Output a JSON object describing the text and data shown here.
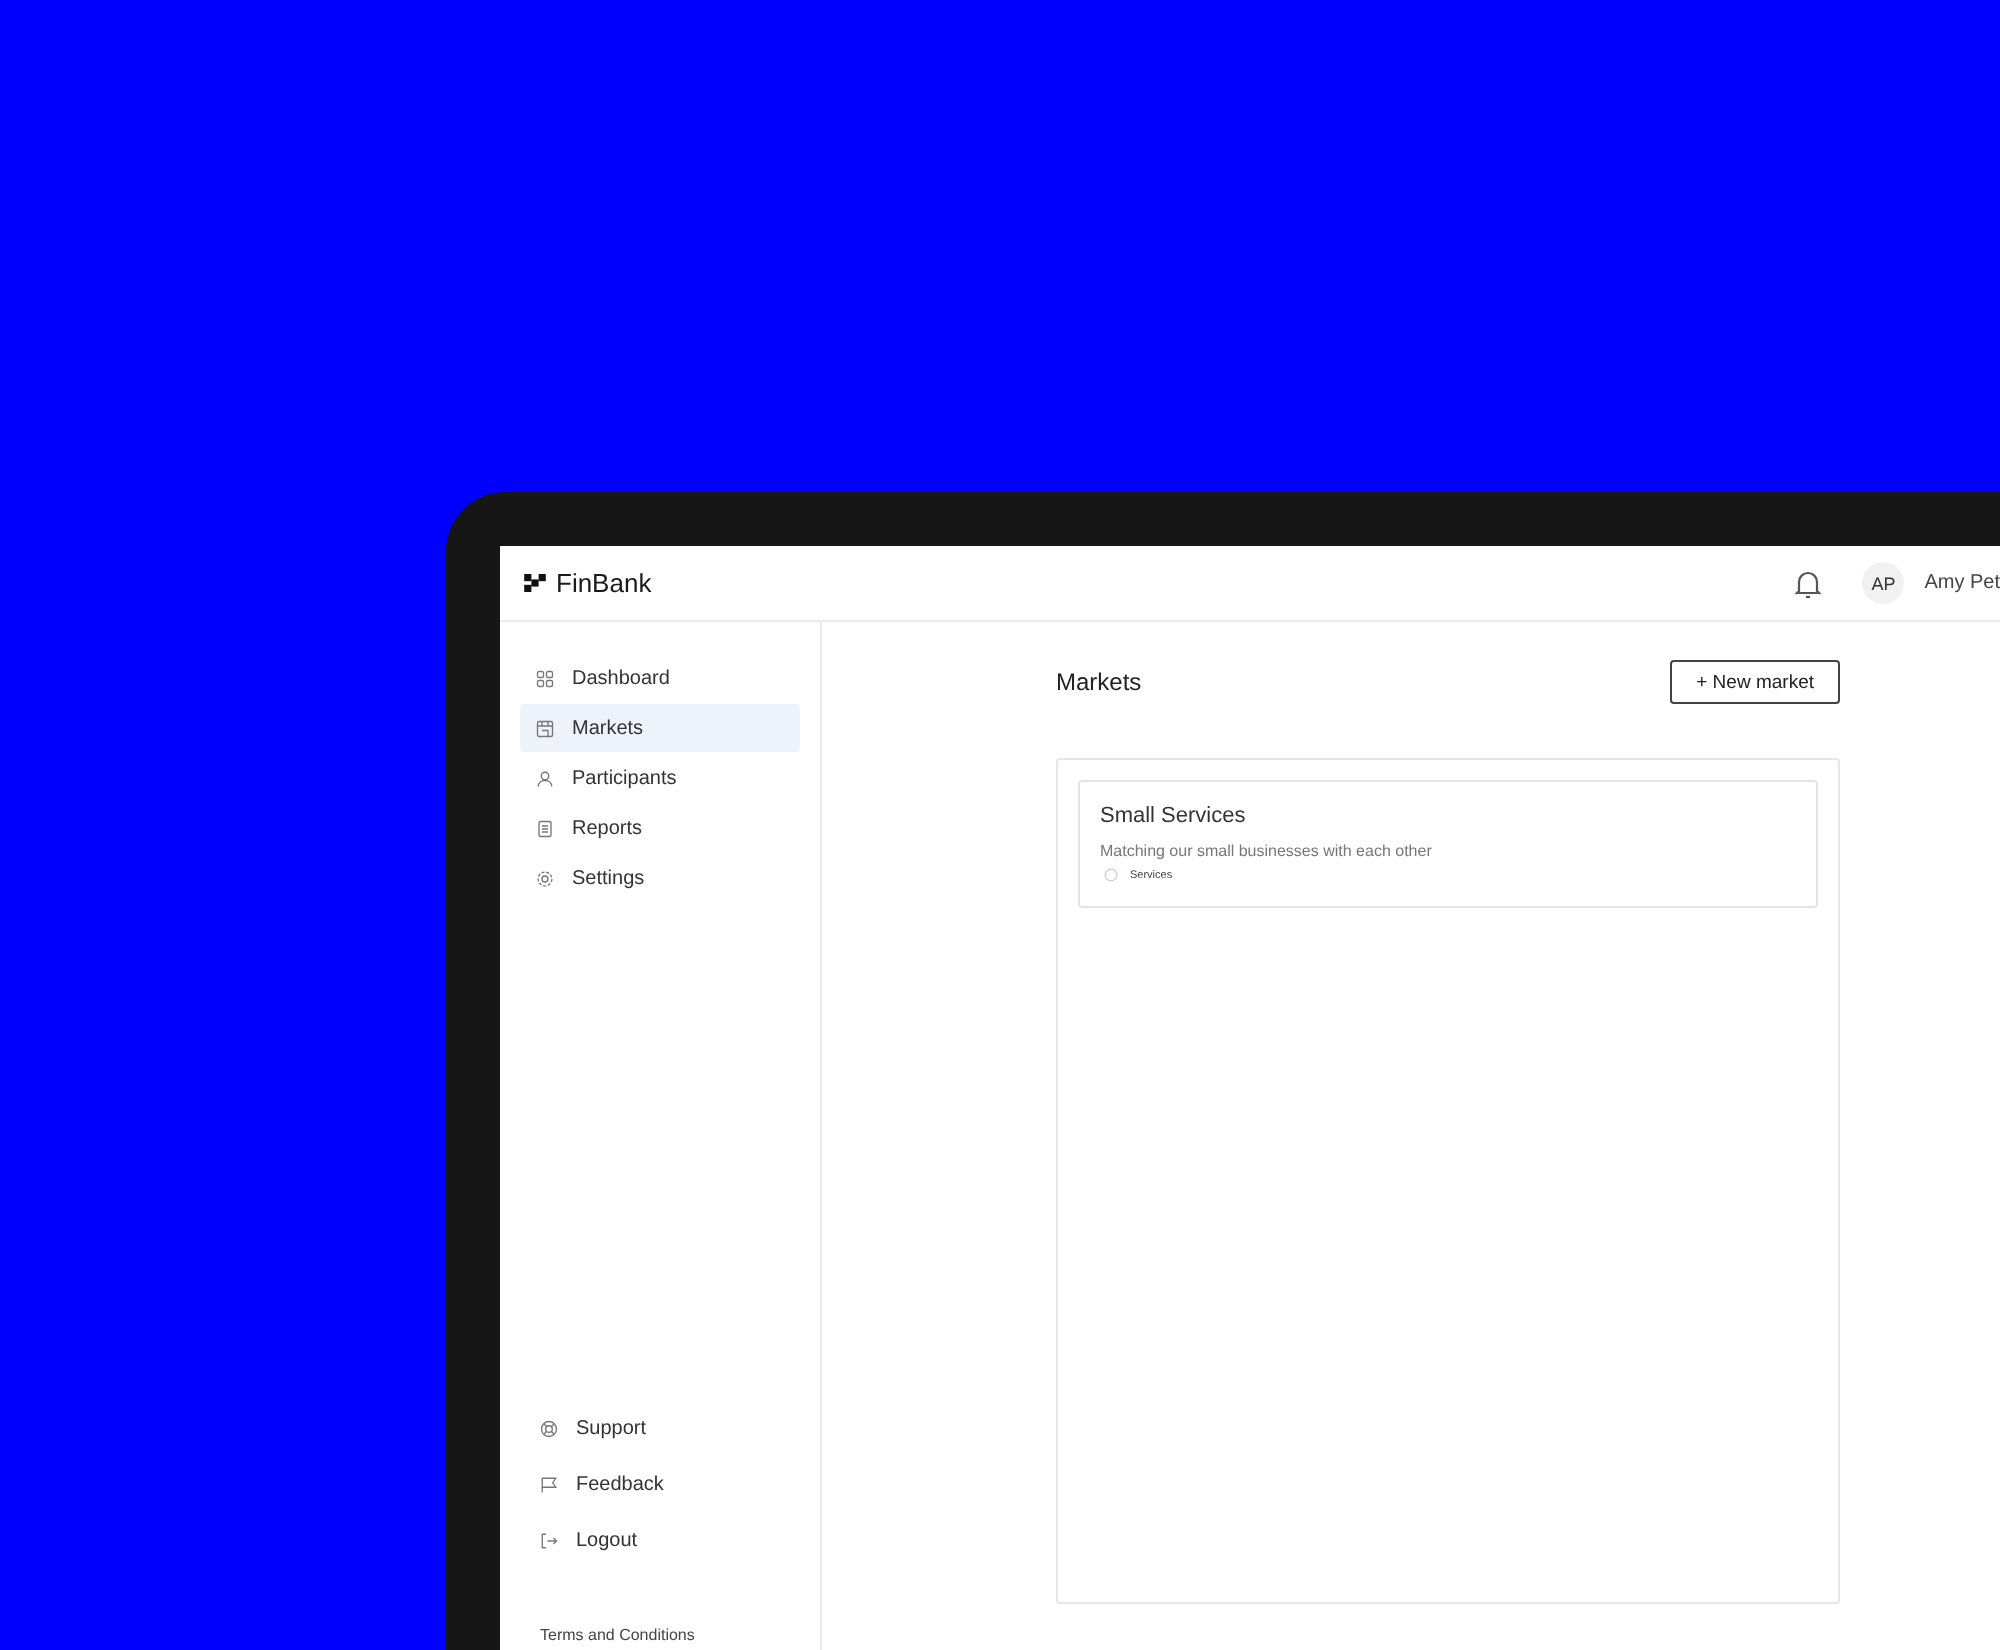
{
  "brand": {
    "name": "FinBank"
  },
  "header": {
    "user_initials": "AP",
    "user_name": "Amy Pet"
  },
  "sidebar": {
    "items": [
      {
        "label": "Dashboard",
        "kind": "grid",
        "selected": false
      },
      {
        "label": "Markets",
        "kind": "store",
        "selected": true
      },
      {
        "label": "Participants",
        "kind": "person",
        "selected": false
      },
      {
        "label": "Reports",
        "kind": "report",
        "selected": false
      },
      {
        "label": "Settings",
        "kind": "gear",
        "selected": false
      }
    ],
    "bottom_items": [
      {
        "label": "Support",
        "kind": "lifebuoy"
      },
      {
        "label": "Feedback",
        "kind": "flag"
      },
      {
        "label": "Logout",
        "kind": "logout"
      }
    ],
    "footer_link": "Terms and Conditions"
  },
  "page": {
    "title": "Markets",
    "new_button": "+ New market",
    "markets": [
      {
        "name": "Small Services",
        "description": "Matching our small businesses with each other",
        "tags": [
          "Services"
        ]
      }
    ]
  }
}
